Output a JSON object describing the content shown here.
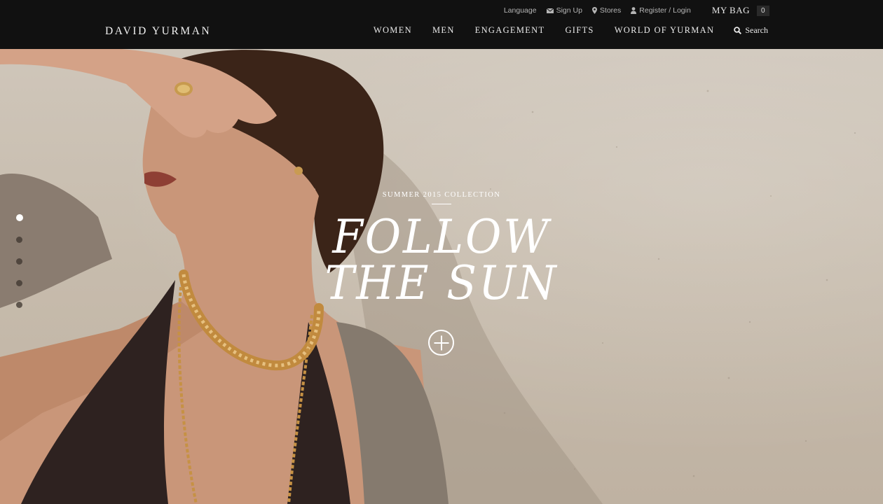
{
  "header": {
    "logo": "DAVID YURMAN",
    "utility": {
      "language": "Language",
      "signup": "Sign Up",
      "stores": "Stores",
      "register_login": "Register / Login",
      "bag_label": "MY BAG",
      "bag_count": "0"
    },
    "nav": [
      "WOMEN",
      "MEN",
      "ENGAGEMENT",
      "GIFTS",
      "WORLD OF YURMAN"
    ],
    "search_label": "Search"
  },
  "hero": {
    "eyebrow": "SUMMER 2015 COLLECTION",
    "headline_line1": "FOLLOW",
    "headline_line2": "THE SUN",
    "slides_total": 5,
    "active_slide": 1
  },
  "colors": {
    "header_bg": "#111111",
    "hero_text": "#ffffff",
    "wall": "#c9bfb1"
  }
}
